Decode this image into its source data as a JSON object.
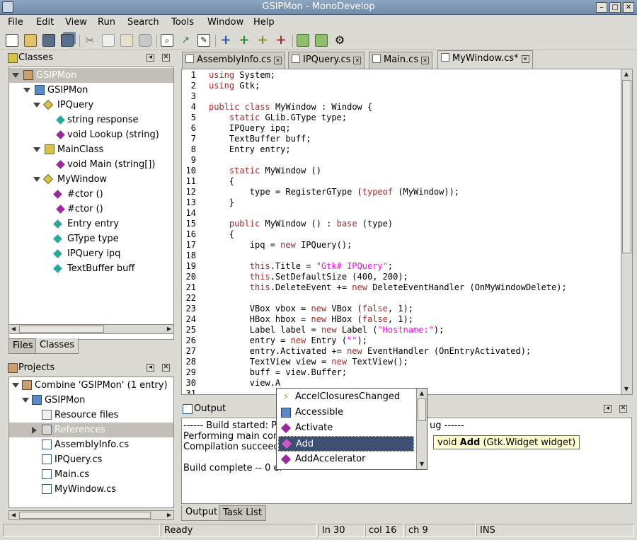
{
  "window": {
    "title": "GSIPMon - MonoDevelop"
  },
  "menubar": {
    "items": [
      "File",
      "Edit",
      "View",
      "Run",
      "Search",
      "Tools",
      "Window",
      "Help"
    ]
  },
  "toolbar": {
    "buttons": [
      "new-file-icon",
      "open-icon",
      "save-icon",
      "save-all-icon",
      "cut-icon",
      "copy-icon",
      "paste-icon",
      "delete-icon",
      "find-icon",
      "build-icon",
      "rebuild-icon",
      "add-icon",
      "add-green-icon",
      "add-yellow-icon",
      "remove-icon",
      "run-icon",
      "debug-icon",
      "settings-icon"
    ]
  },
  "classes_pad": {
    "title": "Classes",
    "tree": [
      {
        "label": "GSIPMon",
        "selected": true
      },
      {
        "label": "GSIPMon"
      },
      {
        "label": "IPQuery"
      },
      {
        "label": "string response"
      },
      {
        "label": "void Lookup (string)"
      },
      {
        "label": "MainClass"
      },
      {
        "label": "void Main (string[])"
      },
      {
        "label": "MyWindow"
      },
      {
        "label": "#ctor ()"
      },
      {
        "label": "#ctor ()"
      },
      {
        "label": "Entry entry"
      },
      {
        "label": "GType type"
      },
      {
        "label": "IPQuery ipq"
      },
      {
        "label": "TextBuffer buff"
      }
    ],
    "tabs": [
      "Files",
      "Classes"
    ]
  },
  "projects_pad": {
    "title": "Projects",
    "tree": [
      {
        "label": "Combine 'GSIPMon' (1 entry)"
      },
      {
        "label": "GSIPMon"
      },
      {
        "label": "Resource files"
      },
      {
        "label": "References",
        "selected": true
      },
      {
        "label": "AssemblyInfo.cs"
      },
      {
        "label": "IPQuery.cs"
      },
      {
        "label": "Main.cs"
      },
      {
        "label": "MyWindow.cs"
      }
    ]
  },
  "editor": {
    "tabs": [
      "AssemblyInfo.cs",
      "IPQuery.cs",
      "Main.cs",
      "MyWindow.cs*"
    ],
    "active_tab": "MyWindow.cs*",
    "lines": [
      "using System;",
      "using Gtk;",
      "",
      "public class MyWindow : Window {",
      "    static GLib.GType type;",
      "    IPQuery ipq;",
      "    TextBuffer buff;",
      "    Entry entry;",
      "",
      "    static MyWindow ()",
      "    {",
      "        type = RegisterGType (typeof (MyWindow));",
      "    }",
      "",
      "    public MyWindow () : base (type)",
      "    {",
      "        ipq = new IPQuery();",
      "",
      "        this.Title = \"Gtk# IPQuery\";",
      "        this.SetDefaultSize (400, 200);",
      "        this.DeleteEvent += new DeleteEventHandler (OnMyWindowDelete);",
      "",
      "        VBox vbox = new VBox (false, 1);",
      "        HBox hbox = new HBox (false, 1);",
      "        Label label = new Label (\"Hostname:\");",
      "        entry = new Entry (\"\");",
      "        entry.Activated += new EventHandler (OnEntryActivated);",
      "        TextView view = new TextView();",
      "        buff = view.Buffer;",
      "        view.A",
      ""
    ]
  },
  "completion": {
    "items": [
      "AccelClosuresChanged",
      "Accessible",
      "Activate",
      "Add",
      "AddAccelerator"
    ],
    "selected": "Add",
    "tooltip_prefix": "void ",
    "tooltip_bold": "Add",
    "tooltip_suffix": " (Gtk.Widget widget)"
  },
  "output_pad": {
    "title": "Output",
    "lines": [
      "------ Build started: Pro",
      "Performing main com",
      "Compilation succeede",
      "",
      "Build complete -- 0 er"
    ],
    "line0_tail": "ug ------",
    "tabs": [
      "Output",
      "Task List"
    ]
  },
  "statusbar": {
    "message": "Ready",
    "line": "ln 30",
    "col": "col 16",
    "ch": "ch 9",
    "mode": "INS"
  },
  "colors": {
    "keyword": "#a52a2a",
    "string": "#ff00ff",
    "selection": "#3e4f73",
    "type_keyword": "#2e8b57"
  }
}
